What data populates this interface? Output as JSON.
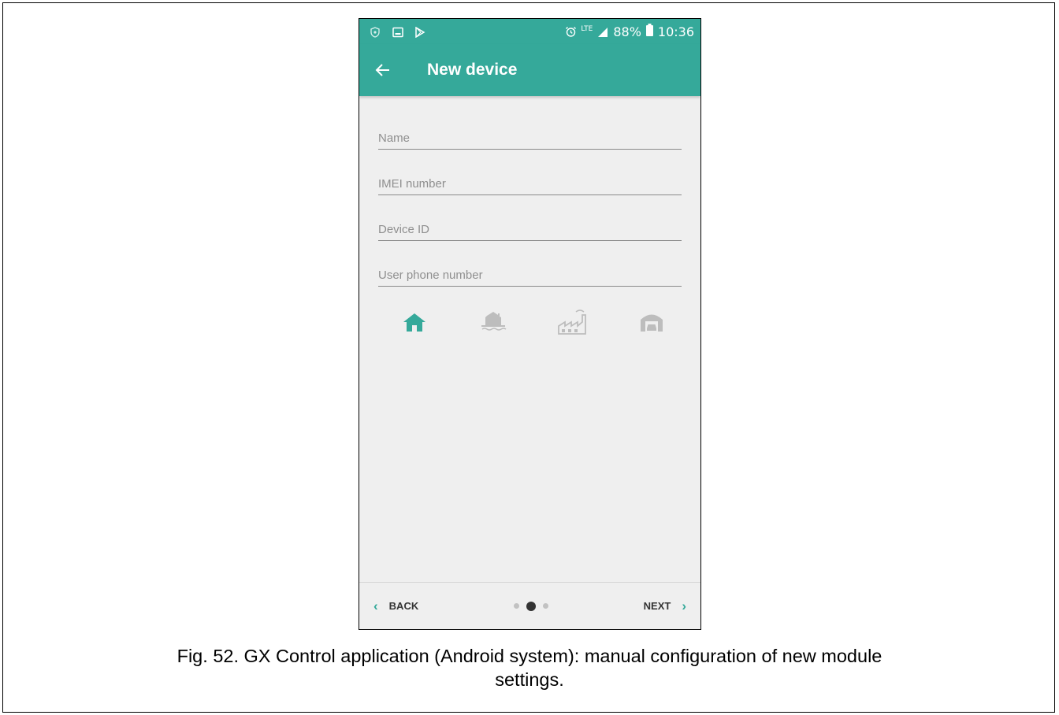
{
  "status_bar": {
    "battery": "88%",
    "time": "10:36",
    "network": "LTE",
    "icons": [
      "shield-icon",
      "image-icon",
      "play-store-icon",
      "alarm-icon",
      "signal-icon",
      "battery-icon"
    ]
  },
  "app_bar": {
    "title": "New device",
    "back_icon": "arrow-left-icon"
  },
  "form": {
    "name_placeholder": "Name",
    "name_value": "",
    "imei_placeholder": "IMEI number",
    "imei_value": "",
    "device_id_placeholder": "Device ID",
    "device_id_value": "",
    "phone_placeholder": "User phone number",
    "phone_value": ""
  },
  "object_types": [
    {
      "icon": "house-icon",
      "selected": true
    },
    {
      "icon": "lake-house-icon",
      "selected": false
    },
    {
      "icon": "factory-icon",
      "selected": false
    },
    {
      "icon": "garage-icon",
      "selected": false
    }
  ],
  "bottom_nav": {
    "back_label": "BACK",
    "next_label": "NEXT",
    "page_count": 3,
    "current_page": 2
  },
  "colors": {
    "accent": "#35a99a",
    "inactive_icon": "#bdbdbd",
    "background": "#efefef"
  },
  "caption": {
    "line1": "Fig. 52. GX Control application (Android system): manual configuration of new module",
    "line2": "settings."
  }
}
